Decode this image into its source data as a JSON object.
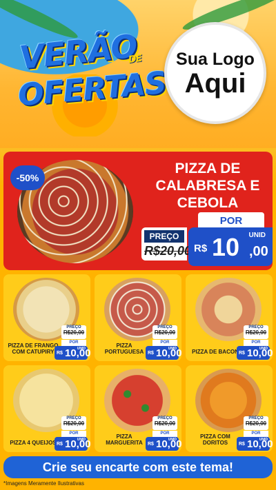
{
  "header": {
    "title_line1": "VERÃO",
    "title_de": "DE",
    "title_line2": "OFERTAS",
    "logo_line1": "Sua Logo",
    "logo_line2": "Aqui"
  },
  "hero": {
    "discount": "-50%",
    "name": "PIZZA DE CALABRESA E CEBOLA",
    "por_label": "POR",
    "preco_label": "PREÇO",
    "old_price": "R$20,00",
    "currency": "R$",
    "price_int": "10",
    "price_cents": ",00",
    "unid": "UNID"
  },
  "products": [
    {
      "name": "PIZZA DE FRANGO COM CATUPIRY",
      "style": "frango"
    },
    {
      "name": "PIZZA PORTUGUESA",
      "style": "portuguesa"
    },
    {
      "name": "PIZZA DE BACON",
      "style": "bacon"
    },
    {
      "name": "PIZZA 4 QUEIJOS",
      "style": "queijo"
    },
    {
      "name": "PIZZA MARGUERITA",
      "style": "marguerita"
    },
    {
      "name": "PIZZA COM DORITOS",
      "style": "doritos"
    }
  ],
  "mini_price": {
    "preco_label": "PREÇO",
    "old_price": "R$20,00",
    "por_label": "POR",
    "currency": "R$",
    "price": "10,00",
    "unid": "UNID"
  },
  "cta": "Crie seu encarte com este tema!",
  "disclaimer": "*Imagens Meramente Ilustrativas",
  "colors": {
    "red": "#e0231c",
    "blue": "#1f50c8",
    "yellow": "#ffcc1a",
    "orange": "#ffb300"
  }
}
